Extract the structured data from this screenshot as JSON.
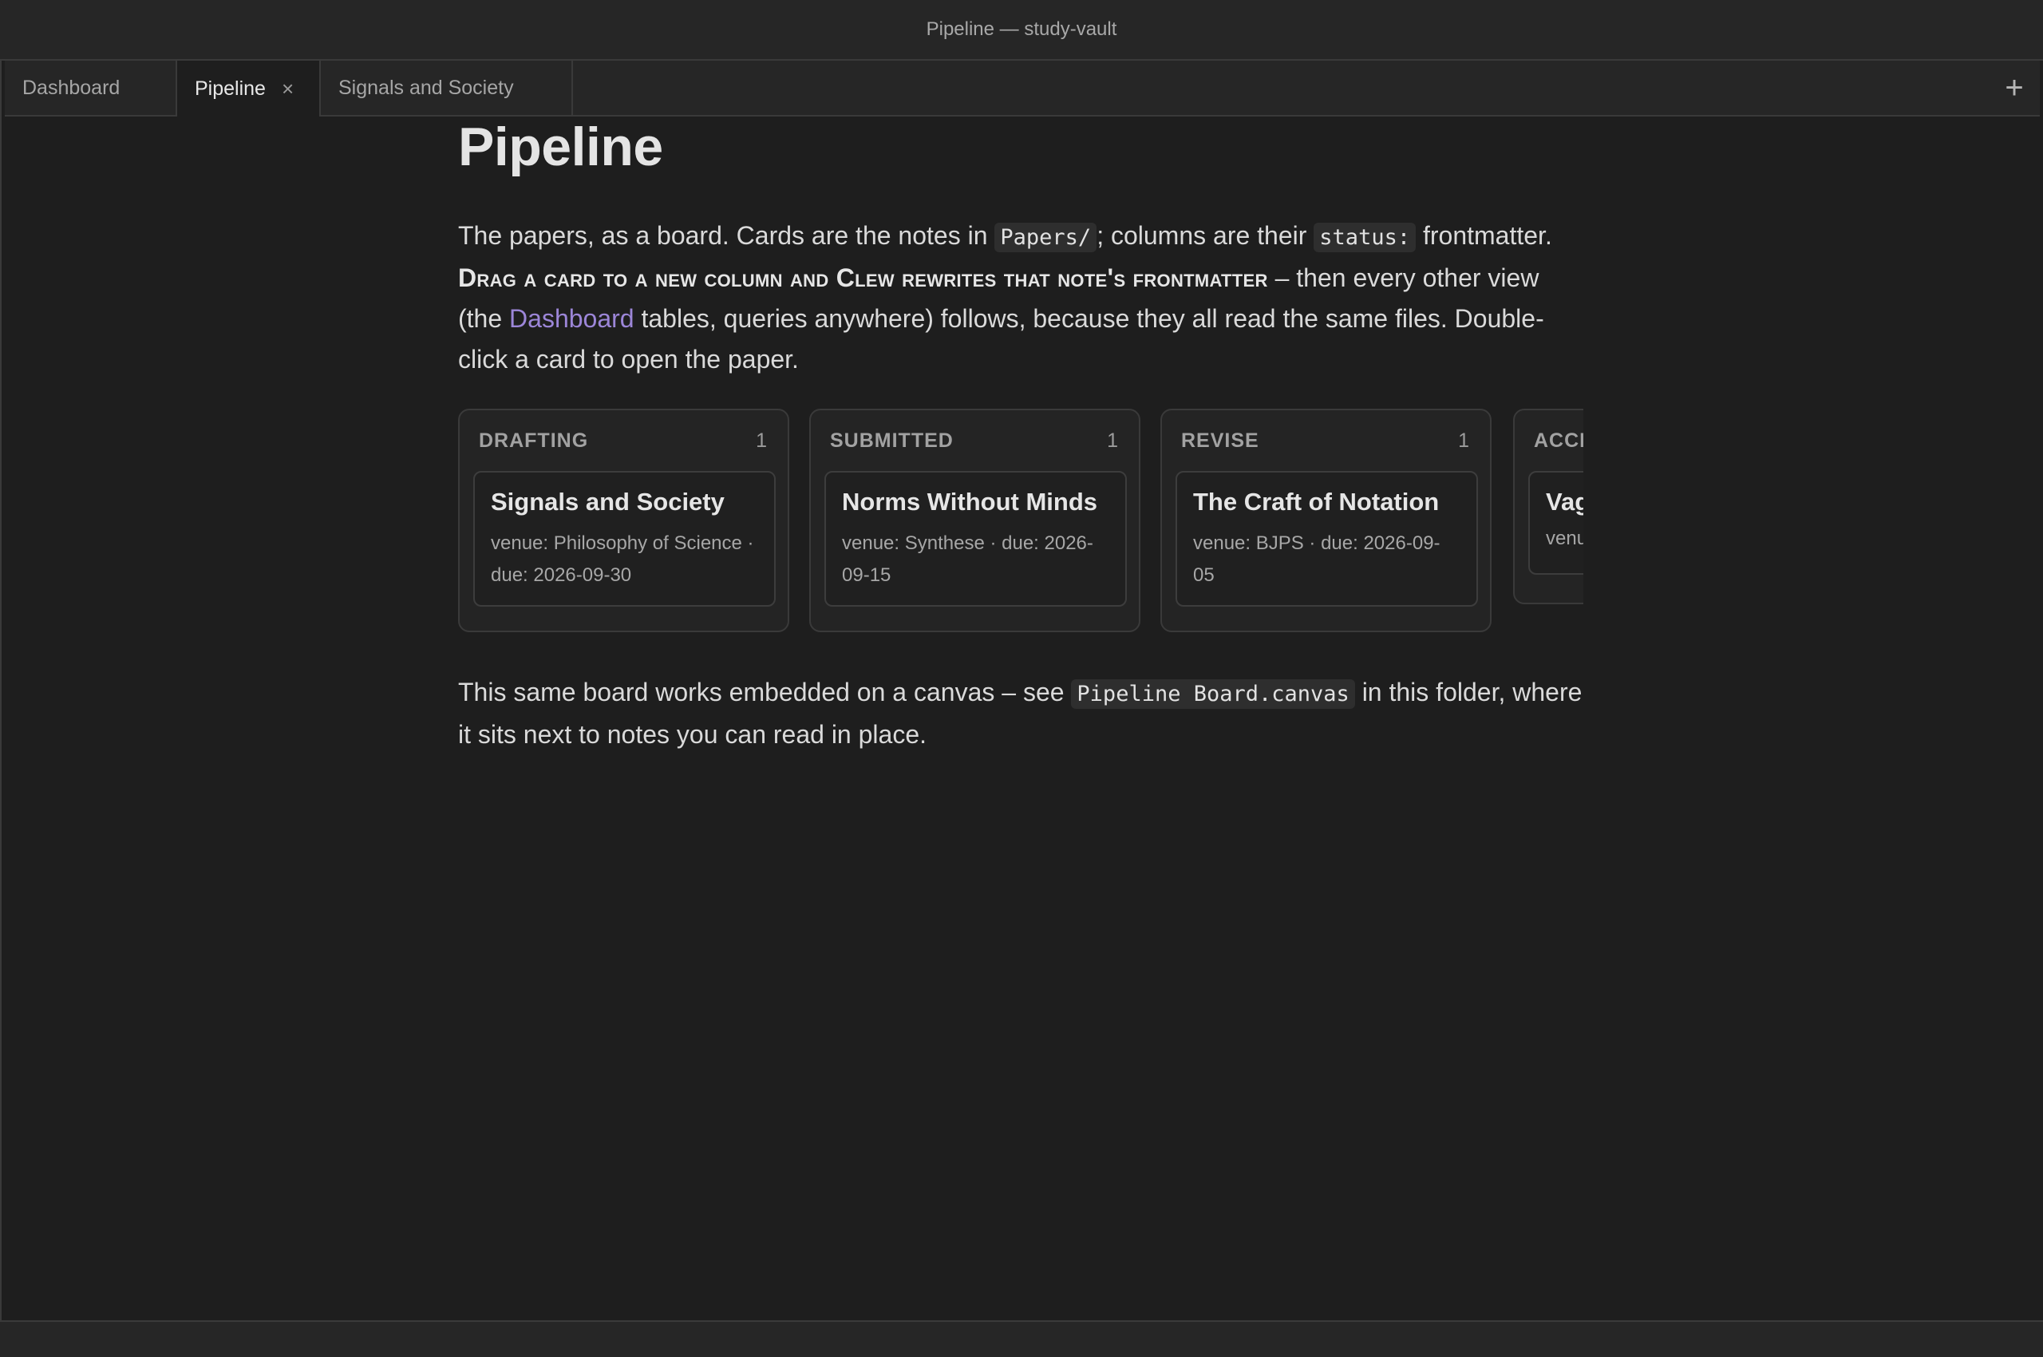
{
  "window": {
    "title": "Pipeline — study-vault"
  },
  "tabs": [
    {
      "label": "Dashboard"
    },
    {
      "label": "Pipeline",
      "close": "×"
    },
    {
      "label": "Signals and Society"
    }
  ],
  "tab_add": "+",
  "page": {
    "title": "Pipeline",
    "intro": {
      "t1": "The papers, as a board. Cards are the notes in ",
      "code1": "Papers/",
      "t2": "; columns are their ",
      "code2": "status:",
      "t3": " frontmatter.",
      "emphasis": "Drag a card to a new column and Clew rewrites that note's frontmatter",
      "t4": " – then every other view (the ",
      "link": "Dashboard",
      "t5": " tables, queries anywhere) follows, because they all read the same files. Double-click a card to open the paper."
    },
    "outro": {
      "t1": "This same board works embedded on a canvas – see ",
      "code": "Pipeline Board.canvas",
      "t2": " in this folder, where it sits next to notes you can read in place."
    }
  },
  "board": {
    "columns": [
      {
        "name": "DRAFTING",
        "count": "1",
        "card": {
          "title": "Signals and Society",
          "meta": "venue: Philosophy of Science · due: 2026-09-30"
        }
      },
      {
        "name": "SUBMITTED",
        "count": "1",
        "card": {
          "title": "Norms Without Minds",
          "meta": "venue: Synthese · due: 2026-09-15"
        }
      },
      {
        "name": "REVISE",
        "count": "1",
        "card": {
          "title": "The Craft of Notation",
          "meta": "venue: BJPS · due: 2026-09-05"
        }
      },
      {
        "name": "ACCI",
        "count": "",
        "card": {
          "title": "Vag",
          "meta": "venu"
        }
      }
    ]
  }
}
